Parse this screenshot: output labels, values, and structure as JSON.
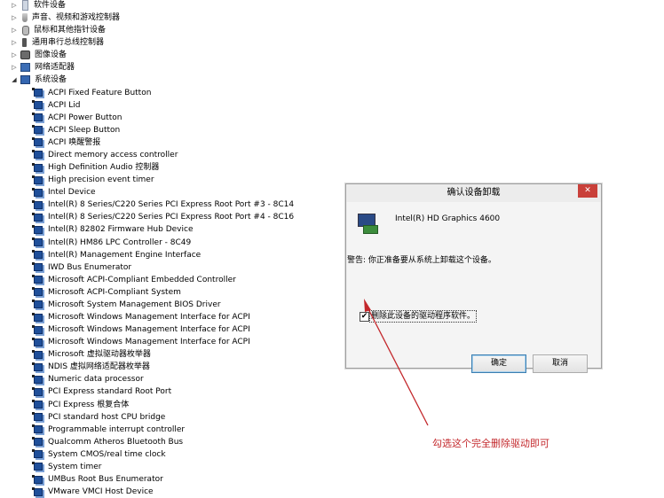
{
  "tree": {
    "categories": [
      {
        "label": "软件设备",
        "icon": "software-icon",
        "state": "collapsed"
      },
      {
        "label": "声音、视频和游戏控制器",
        "icon": "sound-icon",
        "state": "collapsed"
      },
      {
        "label": "鼠标和其他指针设备",
        "icon": "mouse-icon",
        "state": "collapsed"
      },
      {
        "label": "通用串行总线控制器",
        "icon": "usb-icon",
        "state": "collapsed"
      },
      {
        "label": "图像设备",
        "icon": "camera-icon",
        "state": "collapsed"
      },
      {
        "label": "网络适配器",
        "icon": "network-icon",
        "state": "collapsed"
      },
      {
        "label": "系统设备",
        "icon": "system-icon",
        "state": "expanded"
      }
    ],
    "system_devices": [
      "ACPI Fixed Feature Button",
      "ACPI Lid",
      "ACPI Power Button",
      "ACPI Sleep Button",
      "ACPI 唤醒警报",
      "Direct memory access controller",
      "High Definition Audio 控制器",
      "High precision event timer",
      "Intel Device",
      "Intel(R) 8 Series/C220 Series PCI Express Root Port #3 - 8C14",
      "Intel(R) 8 Series/C220 Series PCI Express Root Port #4 - 8C16",
      "Intel(R) 82802 Firmware Hub Device",
      "Intel(R) HM86 LPC Controller - 8C49",
      "Intel(R) Management Engine Interface",
      "IWD Bus Enumerator",
      "Microsoft ACPI-Compliant Embedded Controller",
      "Microsoft ACPI-Compliant System",
      "Microsoft System Management BIOS Driver",
      "Microsoft Windows Management Interface for ACPI",
      "Microsoft Windows Management Interface for ACPI",
      "Microsoft Windows Management Interface for ACPI",
      "Microsoft 虚拟驱动器枚举器",
      "NDIS 虚拟网络适配器枚举器",
      "Numeric data processor",
      "PCI Express standard Root Port",
      "PCI Express 根复合体",
      "PCI standard host CPU bridge",
      "Programmable interrupt controller",
      "Qualcomm Atheros Bluetooth Bus",
      "System CMOS/real time clock",
      "System timer",
      "UMBus Root Bus Enumerator",
      "VMware VMCI Host Device"
    ]
  },
  "dialog": {
    "title": "确认设备卸载",
    "close_label": "✕",
    "device_name": "Intel(R) HD Graphics 4600",
    "warning": "警告: 你正准备要从系统上卸载这个设备。",
    "checkbox_label": "删除此设备的驱动程序软件。",
    "checkbox_checked": true,
    "ok_label": "确定",
    "cancel_label": "取消"
  },
  "annotation": {
    "text": "勾选这个完全删除驱动即可",
    "color": "#c3272b"
  }
}
